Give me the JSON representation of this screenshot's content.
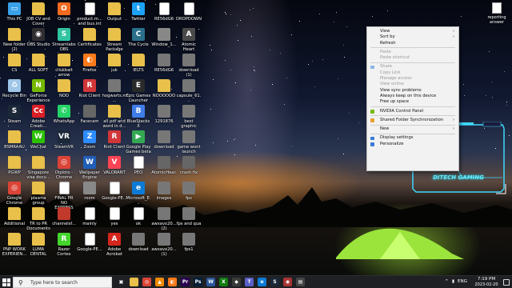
{
  "desktop_icons": [
    {
      "label": "This PC",
      "icon": "pc-icon",
      "color": "#3aa0e8",
      "glyph": "▭"
    },
    {
      "label": "JOB CV and Cover",
      "icon": "folder-icon",
      "color": "#e8c04a",
      "glyph": ""
    },
    {
      "label": "Origin",
      "icon": "origin-icon",
      "color": "#f06a20",
      "glyph": "O"
    },
    {
      "label": "product.m... and bus.int",
      "icon": "document-icon",
      "color": "#ffffff",
      "glyph": ""
    },
    {
      "label": "Output",
      "icon": "folder-icon",
      "color": "#e8c04a",
      "glyph": ""
    },
    {
      "label": "Twitter",
      "icon": "twitter-icon",
      "color": "#1da1f2",
      "glyph": "t"
    },
    {
      "label": "RE56dG6",
      "icon": "file-icon",
      "color": "#ffffff",
      "glyph": ""
    },
    {
      "label": "DROPDOWN",
      "icon": "file-icon",
      "color": "#ffffff",
      "glyph": ""
    },
    {
      "label": "New folder (2)",
      "icon": "folder-icon",
      "color": "#e8c04a",
      "glyph": ""
    },
    {
      "label": "OBS Studio",
      "icon": "obs-icon",
      "color": "#302e31",
      "glyph": "◉"
    },
    {
      "label": "Streamlabs OBS",
      "icon": "streamlabs-icon",
      "color": "#31c3a2",
      "glyph": "S"
    },
    {
      "label": "Certificates",
      "icon": "folder-icon",
      "color": "#e8c04a",
      "glyph": ""
    },
    {
      "label": "Stream Package",
      "icon": "folder-icon",
      "color": "#e8c04a",
      "glyph": ""
    },
    {
      "label": "The Cycle",
      "icon": "game-icon",
      "color": "#2a6f8a",
      "glyph": "C"
    },
    {
      "label": "Window_1...",
      "icon": "image-icon",
      "color": "#888888",
      "glyph": ""
    },
    {
      "label": "Atomic Heart",
      "icon": "game-icon",
      "color": "#4a4a4a",
      "glyph": "A"
    },
    {
      "label": "CS",
      "icon": "folder-icon",
      "color": "#e8c04a",
      "glyph": ""
    },
    {
      "label": "ALL SOFT",
      "icon": "folder-icon",
      "color": "#e8c04a",
      "glyph": ""
    },
    {
      "label": "clickbait arrow",
      "icon": "image-icon",
      "color": "#e8c04a",
      "glyph": ""
    },
    {
      "label": "Firefox",
      "icon": "firefox-icon",
      "color": "#ff7a1a",
      "glyph": "◐"
    },
    {
      "label": "juk",
      "icon": "folder-icon",
      "color": "#e8c04a",
      "glyph": ""
    },
    {
      "label": "IELTS",
      "icon": "folder-icon",
      "color": "#e8c04a",
      "glyph": ""
    },
    {
      "label": "RE56dG6",
      "icon": "image-icon",
      "color": "#777777",
      "glyph": ""
    },
    {
      "label": "download (1)",
      "icon": "image-icon",
      "color": "#777777",
      "glyph": ""
    },
    {
      "label": "Recycle Bin",
      "icon": "recycle-bin-icon",
      "color": "#9fc6e8",
      "glyph": "♻"
    },
    {
      "label": "GeForce Experience",
      "icon": "nvidia-icon",
      "color": "#76b900",
      "glyph": "N"
    },
    {
      "label": "NOO",
      "icon": "folder-icon",
      "color": "#e8c04a",
      "glyph": ""
    },
    {
      "label": "Riot Client",
      "icon": "riot-icon",
      "color": "#d13639",
      "glyph": "R"
    },
    {
      "label": "hogwarts.m...",
      "icon": "image-icon",
      "color": "#777777",
      "glyph": ""
    },
    {
      "label": "Epic Games Launcher",
      "icon": "epic-icon",
      "color": "#2a2a2a",
      "glyph": "E"
    },
    {
      "label": "NOOOOOO",
      "icon": "folder-icon",
      "color": "#e8c04a",
      "glyph": ""
    },
    {
      "label": "capsule_61...",
      "icon": "image-icon",
      "color": "#777777",
      "glyph": ""
    },
    {
      "label": "Steam",
      "icon": "steam-icon",
      "color": "#1b2838",
      "glyph": "S"
    },
    {
      "label": "Adobe Creati...",
      "icon": "adobe-cc-icon",
      "color": "#da1f26",
      "glyph": "Cc"
    },
    {
      "label": "WhatsApp",
      "icon": "whatsapp-icon",
      "color": "#25d366",
      "glyph": "✆"
    },
    {
      "label": "Facecam",
      "icon": "image-icon",
      "color": "#666666",
      "glyph": ""
    },
    {
      "label": "all pdf and word in d...",
      "icon": "folder-icon",
      "color": "#e8c04a",
      "glyph": ""
    },
    {
      "label": "BlueStacks X",
      "icon": "bluestacks-icon",
      "color": "#3f7de8",
      "glyph": "B"
    },
    {
      "label": "1291876",
      "icon": "image-icon",
      "color": "#777777",
      "glyph": ""
    },
    {
      "label": "best graphic",
      "icon": "image-icon",
      "color": "#777777",
      "glyph": ""
    },
    {
      "label": "BSMRAAU",
      "icon": "folder-icon",
      "color": "#e8c04a",
      "glyph": ""
    },
    {
      "label": "WeChat",
      "icon": "wechat-icon",
      "color": "#2dc100",
      "glyph": "W"
    },
    {
      "label": "SteamVR",
      "icon": "steamvr-icon",
      "color": "#1b2838",
      "glyph": "VR"
    },
    {
      "label": "Zoom",
      "icon": "zoom-icon",
      "color": "#2d8cff",
      "glyph": "Z"
    },
    {
      "label": "Riot Client",
      "icon": "riot-icon",
      "color": "#d13639",
      "glyph": "R"
    },
    {
      "label": "Google Play Games beta",
      "icon": "google-play-icon",
      "color": "#34a853",
      "glyph": "▶"
    },
    {
      "label": "download",
      "icon": "image-icon",
      "color": "#777777",
      "glyph": ""
    },
    {
      "label": "game wont launch",
      "icon": "image-icon",
      "color": "#777777",
      "glyph": ""
    },
    {
      "label": "PGWP",
      "icon": "folder-icon",
      "color": "#e8c04a",
      "glyph": ""
    },
    {
      "label": "Singapore visa docu...",
      "icon": "folder-icon",
      "color": "#e8c04a",
      "glyph": ""
    },
    {
      "label": "Diploto - Chrome",
      "icon": "chrome-icon",
      "color": "#db4437",
      "glyph": "◎"
    },
    {
      "label": "Wallpaper Engine",
      "icon": "wallpaper-engine-icon",
      "color": "#1f5fb8",
      "glyph": "W"
    },
    {
      "label": "VALORANT",
      "icon": "valorant-icon",
      "color": "#fa4454",
      "glyph": "V"
    },
    {
      "label": "PEO",
      "icon": "document-icon",
      "color": "#ffffff",
      "glyph": ""
    },
    {
      "label": "AtomicHear...",
      "icon": "image-icon",
      "color": "#666666",
      "glyph": ""
    },
    {
      "label": "crash fix",
      "icon": "image-icon",
      "color": "#666666",
      "glyph": ""
    },
    {
      "label": "Google Chrome",
      "icon": "chrome-icon",
      "color": "#db4437",
      "glyph": "◎"
    },
    {
      "label": "plasma group",
      "icon": "folder-icon",
      "color": "#e8c04a",
      "glyph": ""
    },
    {
      "label": "FINAL PR NO EXPRESS E...",
      "icon": "document-icon",
      "color": "#ffffff",
      "glyph": ""
    },
    {
      "label": "room",
      "icon": "image-icon",
      "color": "#888888",
      "glyph": ""
    },
    {
      "label": "Google-PE...",
      "icon": "document-icon",
      "color": "#ffffff",
      "glyph": ""
    },
    {
      "label": "Microsoft_E...",
      "icon": "edge-icon",
      "color": "#0c7bd6",
      "glyph": "e"
    },
    {
      "label": "images",
      "icon": "image-icon",
      "color": "#777777",
      "glyph": ""
    },
    {
      "label": "fps",
      "icon": "image-icon",
      "color": "#777777",
      "glyph": ""
    },
    {
      "label": "Additional",
      "icon": "folder-icon",
      "color": "#e8c04a",
      "glyph": ""
    },
    {
      "label": "TR to PR Documents",
      "icon": "folder-icon",
      "color": "#e8c04a",
      "glyph": ""
    },
    {
      "label": "channelsf...",
      "icon": "image-icon",
      "color": "#c0392b",
      "glyph": ""
    },
    {
      "label": "mainly",
      "icon": "document-icon",
      "color": "#ffffff",
      "glyph": ""
    },
    {
      "label": "yes",
      "icon": "document-icon",
      "color": "#ffffff",
      "glyph": ""
    },
    {
      "label": "ok",
      "icon": "document-icon",
      "color": "#ffffff",
      "glyph": ""
    },
    {
      "label": "awxavx20... (2)",
      "icon": "image-icon",
      "color": "#777777",
      "glyph": ""
    },
    {
      "label": "fps and qua",
      "icon": "image-icon",
      "color": "#777777",
      "glyph": ""
    },
    {
      "label": "PNP WORK EXPERIEN...",
      "icon": "folder-icon",
      "color": "#e8c04a",
      "glyph": ""
    },
    {
      "label": "LUMA DENTAL",
      "icon": "folder-icon",
      "color": "#e8c04a",
      "glyph": ""
    },
    {
      "label": "Razer Cortex",
      "icon": "razer-icon",
      "color": "#44d62c",
      "glyph": "R"
    },
    {
      "label": "Google-PE...",
      "icon": "document-icon",
      "color": "#ffffff",
      "glyph": ""
    },
    {
      "label": "Adobe Acrobat",
      "icon": "acrobat-icon",
      "color": "#d4261c",
      "glyph": "A"
    },
    {
      "label": "download",
      "icon": "image-icon",
      "color": "#777777",
      "glyph": ""
    },
    {
      "label": "awxavx20... (1)",
      "icon": "image-icon",
      "color": "#777777",
      "glyph": ""
    },
    {
      "label": "fps1",
      "icon": "image-icon",
      "color": "#777777",
      "glyph": ""
    }
  ],
  "reporting_icon": {
    "label": "reporting answer",
    "icon": "document-icon"
  },
  "context_menu": {
    "items": [
      {
        "label": "View",
        "type": "item",
        "submenu": true,
        "disabled": false
      },
      {
        "label": "Sort by",
        "type": "item",
        "submenu": true,
        "disabled": false
      },
      {
        "label": "Refresh",
        "type": "item",
        "submenu": false,
        "disabled": false
      },
      {
        "type": "separator"
      },
      {
        "label": "Paste",
        "type": "item",
        "submenu": false,
        "disabled": true
      },
      {
        "label": "Paste shortcut",
        "type": "item",
        "submenu": false,
        "disabled": true
      },
      {
        "type": "separator"
      },
      {
        "label": "Share",
        "type": "item",
        "submenu": false,
        "disabled": true,
        "icon": "onedrive-icon",
        "icon_color": "#8ab4e6"
      },
      {
        "label": "Copy Link",
        "type": "item",
        "submenu": false,
        "disabled": true
      },
      {
        "label": "Manage access",
        "type": "item",
        "submenu": false,
        "disabled": true
      },
      {
        "label": "View online",
        "type": "item",
        "submenu": false,
        "disabled": true
      },
      {
        "label": "View sync problems",
        "type": "item",
        "submenu": false,
        "disabled": false
      },
      {
        "label": "Always keep on this device",
        "type": "item",
        "submenu": false,
        "disabled": false
      },
      {
        "label": "Free up space",
        "type": "item",
        "submenu": false,
        "disabled": false
      },
      {
        "type": "separator"
      },
      {
        "label": "NVIDIA Control Panel",
        "type": "item",
        "submenu": false,
        "disabled": false,
        "icon": "nvidia-icon",
        "icon_color": "#76b900"
      },
      {
        "type": "separator"
      },
      {
        "label": "Shared Folder Synchronization",
        "type": "item",
        "submenu": true,
        "disabled": false,
        "icon": "sync-icon",
        "icon_color": "#e8a030"
      },
      {
        "type": "separator"
      },
      {
        "label": "New",
        "type": "item",
        "submenu": true,
        "disabled": false
      },
      {
        "type": "separator"
      },
      {
        "label": "Display settings",
        "type": "item",
        "submenu": false,
        "disabled": false,
        "icon": "display-icon",
        "icon_color": "#3a7bd5"
      },
      {
        "label": "Personalize",
        "type": "item",
        "submenu": false,
        "disabled": false,
        "icon": "personalize-icon",
        "icon_color": "#3a7bd5"
      }
    ]
  },
  "overlay": {
    "label": "DITECH GAMING",
    "accent": "#3fd8ff"
  },
  "taskbar": {
    "search_placeholder": "Type here to search",
    "apps": [
      {
        "icon": "task-view-icon",
        "color": "#1f2024",
        "glyph": "▣"
      },
      {
        "icon": "file-explorer-icon",
        "color": "#e8c04a",
        "glyph": ""
      },
      {
        "icon": "chrome-icon",
        "color": "#db4437",
        "glyph": "◎"
      },
      {
        "icon": "vlc-icon",
        "color": "#f08a00",
        "glyph": "▲"
      },
      {
        "icon": "firefox-icon",
        "color": "#ff7a1a",
        "glyph": "◐"
      },
      {
        "icon": "premiere-icon",
        "color": "#2a0050",
        "glyph": "Pr"
      },
      {
        "icon": "photoshop-icon",
        "color": "#001e36",
        "glyph": "Ps"
      },
      {
        "icon": "word-icon",
        "color": "#2b579a",
        "glyph": "W"
      },
      {
        "icon": "xbox-icon",
        "color": "#107c10",
        "glyph": "X"
      },
      {
        "icon": "app-icon",
        "color": "#3a3a3a",
        "glyph": "◆"
      },
      {
        "icon": "teams-icon",
        "color": "#5b5fc7",
        "glyph": "T"
      },
      {
        "icon": "edge-icon",
        "color": "#0c7bd6",
        "glyph": "e"
      },
      {
        "icon": "steam-icon",
        "color": "#1b2838",
        "glyph": "S"
      },
      {
        "icon": "app-icon",
        "color": "#a33",
        "glyph": "◉"
      },
      {
        "icon": "app-icon",
        "color": "#444",
        "glyph": "▤"
      }
    ],
    "tray": {
      "chevron": "^",
      "language": "ENG"
    },
    "time": "7:19 PM",
    "date": "2023-02-20"
  }
}
